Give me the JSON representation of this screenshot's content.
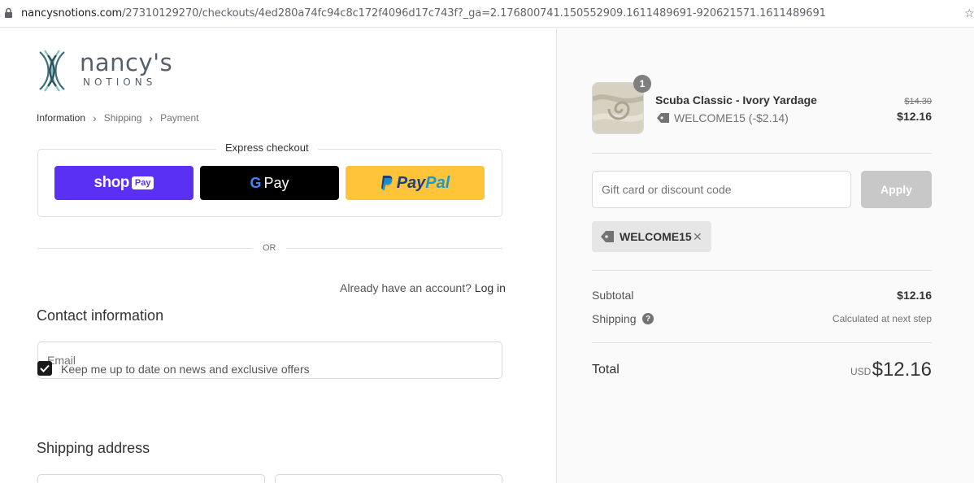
{
  "browser": {
    "url_host": "nancysnotions.com",
    "url_path": "/27310129270/checkouts/4ed280a74fc94c8c172f4096d17c743f?_ga=2.176800741.150552909.1611489691-920621571.1611489691"
  },
  "brand": {
    "name": "nancy's",
    "sub": "NOTIONS",
    "color": "#55606b"
  },
  "breadcrumb": {
    "items": [
      "Information",
      "Shipping",
      "Payment"
    ],
    "active_index": 0
  },
  "express": {
    "title": "Express checkout",
    "shoppay_label": "shop",
    "shoppay_tag": "Pay",
    "gpay_g": "G",
    "gpay_label": "Pay",
    "paypal_pay": "Pay",
    "paypal_pal": "Pal",
    "colors": {
      "shoppay": "#5a31f4",
      "gpay": "#000000",
      "paypal": "#ffc439"
    }
  },
  "or_text": "OR",
  "contact": {
    "title": "Contact information",
    "account_prompt": "Already have an account?",
    "login_label": "Log in",
    "email_placeholder": "Email",
    "newsletter_label": "Keep me up to date on news and exclusive offers",
    "newsletter_checked": true
  },
  "shipping_address": {
    "title": "Shipping address"
  },
  "order": {
    "quantity": "1",
    "product_name": "Scuba Classic - Ivory Yardage",
    "discount_line": "WELCOME15 (-$2.14)",
    "price_original": "$14.30",
    "price_final": "$12.16",
    "discount_placeholder": "Gift card or discount code",
    "apply_label": "Apply",
    "applied_code": "WELCOME15",
    "remove_glyph": "✕",
    "subtotal_label": "Subtotal",
    "subtotal_value": "$12.16",
    "shipping_label": "Shipping",
    "shipping_help": "?",
    "shipping_value": "Calculated at next step",
    "total_label": "Total",
    "total_currency": "USD",
    "total_value": "$12.16"
  }
}
